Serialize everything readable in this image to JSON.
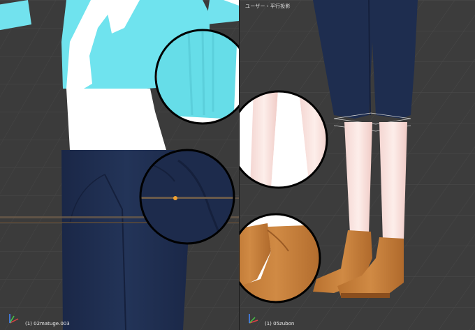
{
  "viewports": {
    "left": {
      "header": "",
      "footer": "(1) 02matuge.003"
    },
    "right": {
      "header": "ユーザー・平行投影",
      "footer": "(1) 05zubon"
    }
  },
  "colors": {
    "background": "#3c3c3c",
    "grid": "#4a4a4a",
    "sweater": "#6fe3ee",
    "shirt": "#ffffff",
    "pants": "#1e2d4f",
    "skin": "#fce9e6",
    "sock": "#ffffff",
    "boot": "#c8803e",
    "lens_border": "#000000"
  },
  "icons": {
    "axis": "axis-gizmo-icon"
  }
}
